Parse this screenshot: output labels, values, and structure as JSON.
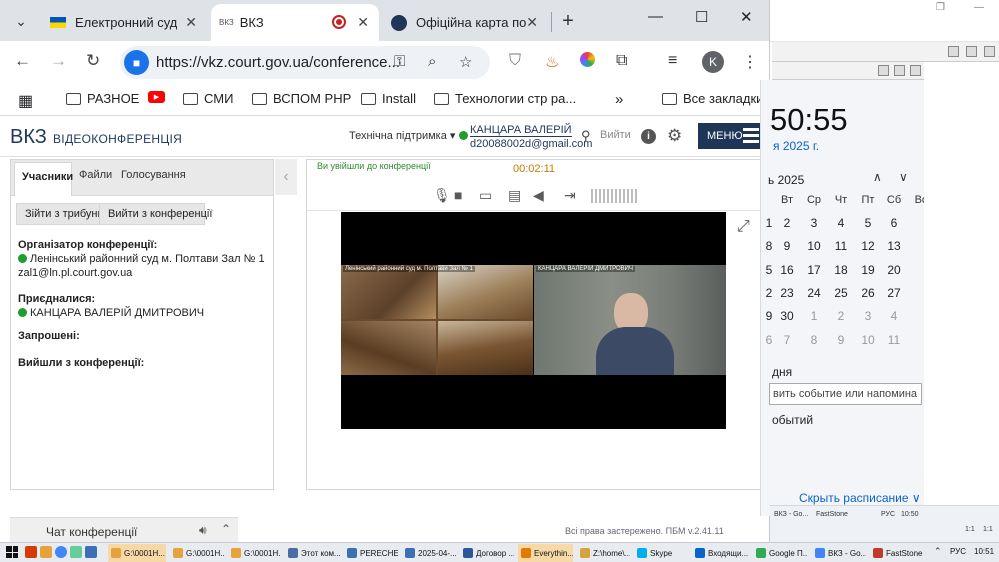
{
  "browser": {
    "tabs": [
      {
        "title": "Електронний суд",
        "active": false
      },
      {
        "title": "ВКЗ",
        "prefix": "ВКЗ",
        "active": true
      },
      {
        "title": "Офіційна карта по",
        "active": false
      }
    ],
    "new_tab": "+",
    "url": "https://vkz.court.gov.ua/conference...",
    "bookmarks": [
      "РАЗНОЕ",
      "",
      "СМИ",
      "ВСПОМ PHP",
      "Install",
      "Технологии стр ра...",
      "Все закладки"
    ],
    "bookmarks_more": "»",
    "profile_initial": "K"
  },
  "site": {
    "logo": "ВКЗ",
    "logo_sub": "ВІДЕОКОНФЕРЕНЦІЯ",
    "support": "Технічна підтримка ▾",
    "user_name": "КАНЦАРА ВАЛЕРІЙ",
    "user_email": "d20088002d@gmail.com",
    "logout": "Вийти",
    "menu": "МЕНЮ",
    "copyright": "Всі права застережено. ПБМ v.2.41.11"
  },
  "left_panel": {
    "tabs": [
      "Учасники",
      "Файли",
      "Голосування"
    ],
    "buttons": [
      "Зійти з трибуни",
      "Вийти з конференції"
    ],
    "organizer_title": "Організатор конференції:",
    "organizer_name": "Ленінський районний суд м. Полтави Зал № 1",
    "organizer_email": "zal1@ln.pl.court.gov.ua",
    "joined_title": "Приєдналися:",
    "joined_name": "КАНЦАРА ВАЛЕРІЙ ДМИТРОВИЧ",
    "invited_title": "Запрошені:",
    "left_title": "Вийшли з конференції:"
  },
  "conference": {
    "joined_message": "Ви увійшли до конференції",
    "timer": "00:02:11",
    "tile_court_label": "Ленінський районний суд м. Полтави Зал № 1",
    "tile_user_label": "КАНЦАРА ВАЛЕРІЙ ДМИТРОВИЧ"
  },
  "chat": {
    "title": "Чат конференції"
  },
  "calendar": {
    "time": "50:55",
    "date": "я 2025 г.",
    "month": "ь 2025",
    "weekdays": [
      "",
      "Вт",
      "Ср",
      "Чт",
      "Пт",
      "Сб",
      "Вс"
    ],
    "weeks": [
      [
        "1",
        "2",
        "3",
        "4",
        "5",
        "6"
      ],
      [
        "8",
        "9",
        "10",
        "11",
        "12",
        "13"
      ],
      [
        "5",
        "16",
        "17",
        "18",
        "19",
        "20"
      ],
      [
        "2",
        "23",
        "24",
        "25",
        "26",
        "27"
      ],
      [
        "9",
        "30",
        "1",
        "2",
        "3",
        "4"
      ],
      [
        "6",
        "7",
        "8",
        "9",
        "10",
        "11"
      ]
    ],
    "note": "дня",
    "input_placeholder": "вить событие или напомина",
    "events": "обытий",
    "hide": "Скрыть расписание ∨"
  },
  "right_taskbar": {
    "items": [
      "ВКЗ - Go...",
      "FastStone",
      "РУС",
      "10:50"
    ],
    "bottom": [
      "1:1",
      "1:1"
    ]
  },
  "taskbar": {
    "items": [
      {
        "label": "G:\\0001Н...",
        "color": "#e6a23c",
        "highlight": true
      },
      {
        "label": "G:\\0001Н...",
        "color": "#e6a23c",
        "highlight": false
      },
      {
        "label": "G:\\0001Н...",
        "color": "#e6a23c",
        "highlight": false
      },
      {
        "label": "Этот ком...",
        "color": "#4a6fa5",
        "highlight": false
      },
      {
        "label": "PERECHE...",
        "color": "#3b6fb6",
        "highlight": false
      },
      {
        "label": "2025-04-...",
        "color": "#3b6fb6",
        "highlight": false
      },
      {
        "label": "Договор ...",
        "color": "#2b579a",
        "highlight": false
      },
      {
        "label": "Everythin...",
        "color": "#e07b00",
        "highlight": true
      },
      {
        "label": "Z:\\home\\...",
        "color": "#d9a23c",
        "highlight": false
      },
      {
        "label": "Skype",
        "color": "#00aff0",
        "highlight": false
      },
      {
        "label": "Входящи...",
        "color": "#0a64c8",
        "highlight": false
      },
      {
        "label": "Google П...",
        "color": "#34a853",
        "highlight": false
      },
      {
        "label": "ВКЗ - Go...",
        "color": "#4285f4",
        "highlight": false
      },
      {
        "label": "FastStone",
        "color": "#c0392b",
        "highlight": false
      }
    ],
    "lang": "РУС",
    "time": "10:51"
  },
  "colors": {
    "site_navy": "#1f3658",
    "online_green": "#1f9d2f",
    "timer_orange": "#c57a00",
    "calendar_blue": "#0a64c8"
  }
}
